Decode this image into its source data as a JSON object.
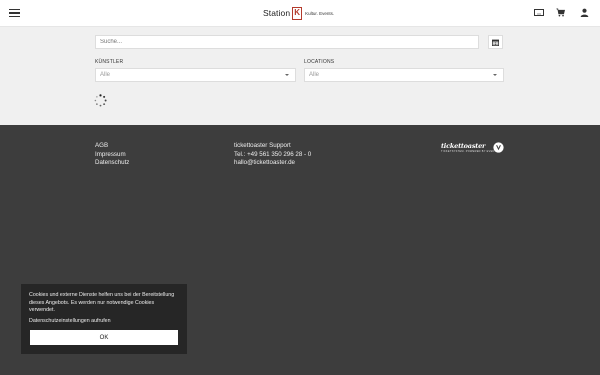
{
  "header": {
    "logo": {
      "station": "Station",
      "k": "K",
      "tagline": "Kultur. Events."
    },
    "icons": [
      "menu-icon",
      "voucher-icon",
      "cart-icon",
      "user-icon"
    ]
  },
  "search": {
    "placeholder": "Suche..."
  },
  "filters": {
    "artists": {
      "label": "KÜNSTLER",
      "value": "Alle"
    },
    "locations": {
      "label": "LOCATIONS",
      "value": "Alle"
    }
  },
  "footer": {
    "links": [
      "AGB",
      "Impressum",
      "Datenschutz"
    ],
    "support": {
      "title": "tickettoaster Support",
      "phone": "Tel.: +49 561 350 296 28 - 0",
      "email": "hallo@tickettoaster.de"
    },
    "brand": {
      "name": "tickettoaster",
      "subline": "TICKETSYSTEM. POWERED BY EVENTIM"
    }
  },
  "cookie": {
    "text": "Cookies und externe Dienste helfen uns bei der Bereitstellung dieses Angebots. Es werden nur notwendige Cookies verwendet.",
    "settings": "Datenschutzeinstellungen aufrufen",
    "ok": "OK"
  },
  "colors": {
    "accent": "#b43a2c",
    "footer_bg": "#3d3d3d",
    "cookie_bg": "#262626"
  }
}
